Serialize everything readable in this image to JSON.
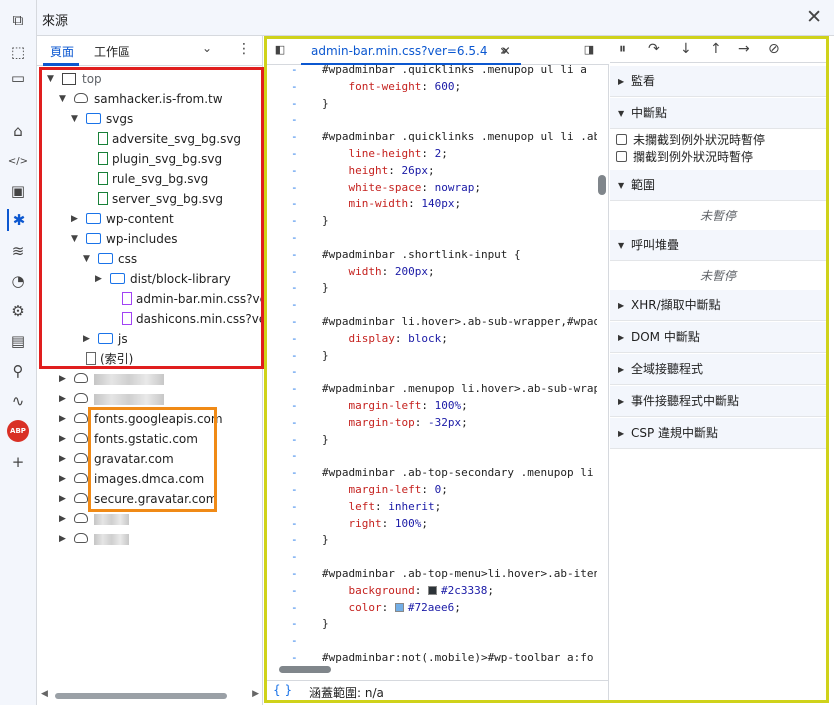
{
  "window": {
    "title": "來源"
  },
  "navigator": {
    "tabs": [
      "頁面",
      "工作區"
    ],
    "tree": [
      {
        "label": "top",
        "kind": "frame",
        "depth": 0,
        "expanded": true
      },
      {
        "label": "samhacker.is-from.tw",
        "kind": "cloud",
        "depth": 1,
        "expanded": true
      },
      {
        "label": "svgs",
        "kind": "folder",
        "depth": 2,
        "expanded": true
      },
      {
        "label": "adversite_svg_bg.svg",
        "kind": "file",
        "depth": 3
      },
      {
        "label": "plugin_svg_bg.svg",
        "kind": "file",
        "depth": 3
      },
      {
        "label": "rule_svg_bg.svg",
        "kind": "file",
        "depth": 3
      },
      {
        "label": "server_svg_bg.svg",
        "kind": "file",
        "depth": 3
      },
      {
        "label": "wp-content",
        "kind": "folder",
        "depth": 2,
        "expanded": false
      },
      {
        "label": "wp-includes",
        "kind": "folder",
        "depth": 2,
        "expanded": true
      },
      {
        "label": "css",
        "kind": "folder",
        "depth": 3,
        "expanded": true
      },
      {
        "label": "dist/block-library",
        "kind": "folder",
        "depth": 4,
        "expanded": false
      },
      {
        "label": "admin-bar.min.css?ver=6.5.4",
        "kind": "css",
        "depth": 5
      },
      {
        "label": "dashicons.min.css?ver=6.5.4",
        "kind": "css",
        "depth": 5
      },
      {
        "label": "js",
        "kind": "folder",
        "depth": 3,
        "expanded": false
      },
      {
        "label": "(索引)",
        "kind": "page",
        "depth": 2
      },
      {
        "label": "",
        "kind": "blur",
        "depth": 1,
        "expanded": false
      },
      {
        "label": "",
        "kind": "blur",
        "depth": 1,
        "expanded": false
      },
      {
        "label": "fonts.googleapis.com",
        "kind": "cloud",
        "depth": 1,
        "expanded": false
      },
      {
        "label": "fonts.gstatic.com",
        "kind": "cloud",
        "depth": 1,
        "expanded": false
      },
      {
        "label": "gravatar.com",
        "kind": "cloud",
        "depth": 1,
        "expanded": false
      },
      {
        "label": "images.dmca.com",
        "kind": "cloud",
        "depth": 1,
        "expanded": false
      },
      {
        "label": "secure.gravatar.com",
        "kind": "cloud",
        "depth": 1,
        "expanded": false
      },
      {
        "label": "",
        "kind": "blur",
        "depth": 1,
        "expanded": false
      },
      {
        "label": "",
        "kind": "blur",
        "depth": 1,
        "expanded": false
      }
    ]
  },
  "editor": {
    "tab_label": "admin-bar.min.css?ver=6.5.4",
    "status": "涵蓋範圍: n/a",
    "lines": [
      {
        "t": "sel",
        "s": "#wpadminbar .quicklinks .menupop ul li a"
      },
      {
        "t": "decl",
        "p": "font-weight",
        "v": "600"
      },
      {
        "t": "plain",
        "s": "}"
      },
      {
        "t": "plain",
        "s": ""
      },
      {
        "t": "sel",
        "s": "#wpadminbar .quicklinks .menupop ul li .ab"
      },
      {
        "t": "decl",
        "p": "line-height",
        "v": "2"
      },
      {
        "t": "decl",
        "p": "height",
        "v": "26px"
      },
      {
        "t": "decl",
        "p": "white-space",
        "v": "nowrap"
      },
      {
        "t": "decl",
        "p": "min-width",
        "v": "140px"
      },
      {
        "t": "plain",
        "s": "}"
      },
      {
        "t": "plain",
        "s": ""
      },
      {
        "t": "sel",
        "s": "#wpadminbar .shortlink-input {"
      },
      {
        "t": "decl",
        "p": "width",
        "v": "200px"
      },
      {
        "t": "plain",
        "s": "}"
      },
      {
        "t": "plain",
        "s": ""
      },
      {
        "t": "sel",
        "s": "#wpadminbar li.hover>.ab-sub-wrapper,#wpad"
      },
      {
        "t": "decl",
        "p": "display",
        "v": "block"
      },
      {
        "t": "plain",
        "s": "}"
      },
      {
        "t": "plain",
        "s": ""
      },
      {
        "t": "sel",
        "s": "#wpadminbar .menupop li.hover>.ab-sub-wrap"
      },
      {
        "t": "decl",
        "p": "margin-left",
        "v": "100%"
      },
      {
        "t": "decl",
        "p": "margin-top",
        "v": "-32px"
      },
      {
        "t": "plain",
        "s": "}"
      },
      {
        "t": "plain",
        "s": ""
      },
      {
        "t": "sel",
        "s": "#wpadminbar .ab-top-secondary .menupop li"
      },
      {
        "t": "decl",
        "p": "margin-left",
        "v": "0"
      },
      {
        "t": "decl",
        "p": "left",
        "v": "inherit"
      },
      {
        "t": "decl",
        "p": "right",
        "v": "100%"
      },
      {
        "t": "plain",
        "s": "}"
      },
      {
        "t": "plain",
        "s": ""
      },
      {
        "t": "sel",
        "s": "#wpadminbar .ab-top-menu>li.hover>.ab-iten"
      },
      {
        "t": "decl",
        "p": "background",
        "v": "#2c3338",
        "swatch": "#2c3338"
      },
      {
        "t": "decl",
        "p": "color",
        "v": "#72aee6",
        "swatch": "#72aee6"
      },
      {
        "t": "plain",
        "s": "}"
      },
      {
        "t": "plain",
        "s": ""
      },
      {
        "t": "sel",
        "s": "#wpadminbar:not(.mobile)>#wp-toolbar a:fo"
      }
    ]
  },
  "debugger": {
    "sections": [
      {
        "label": "監看",
        "open": false
      },
      {
        "label": "中斷點",
        "open": true
      },
      {
        "label": "範圍",
        "open": true
      },
      {
        "label": "呼叫堆疊",
        "open": true
      },
      {
        "label": "XHR/擷取中斷點",
        "open": false
      },
      {
        "label": "DOM 中斷點",
        "open": false
      },
      {
        "label": "全域接聽程式",
        "open": false
      },
      {
        "label": "事件接聽程式中斷點",
        "open": false
      },
      {
        "label": "CSP 違規中斷點",
        "open": false
      }
    ],
    "checkboxes": [
      "未攔截到例外狀況時暫停",
      "攔截到例外狀況時暫停"
    ],
    "not_paused": "未暫停"
  },
  "sidebar_icons": [
    "device-toolbar-icon",
    "inspect-icon",
    "dock-icon",
    "home-icon",
    "code-icon",
    "console-icon",
    "bug-icon",
    "network-icon",
    "performance-icon",
    "settings-icon",
    "application-icon",
    "lighthouse-icon",
    "recorder-icon",
    "abp-icon",
    "plus-icon"
  ],
  "abp_label": "ABP"
}
